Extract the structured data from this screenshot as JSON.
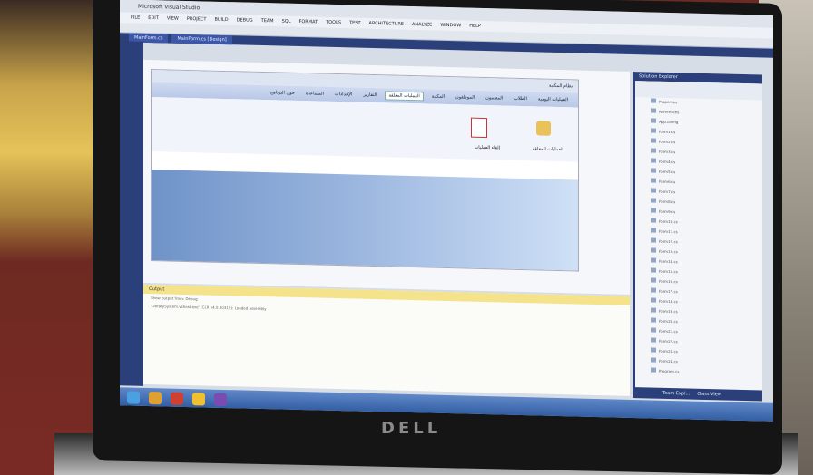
{
  "window": {
    "title": "Microsoft Visual Studio"
  },
  "menu": [
    "FILE",
    "EDIT",
    "VIEW",
    "PROJECT",
    "BUILD",
    "DEBUG",
    "TEAM",
    "SQL",
    "FORMAT",
    "TOOLS",
    "TEST",
    "ARCHITECTURE",
    "ANALYZE",
    "WINDOW",
    "HELP"
  ],
  "tabs": [
    "MainForm.cs",
    "MainForm.cs [Design]"
  ],
  "form": {
    "title": "نظام المكتبة",
    "ribbon_tabs": [
      "العمليات اليومية",
      "الطلاب",
      "المعلمون",
      "الموظفون",
      "المكتبة",
      "العمليات المعلقة",
      "التقارير",
      "الإعدادات",
      "المساعدة",
      "حول البرنامج"
    ],
    "active_tab_index": 5,
    "action_labels": [
      "العمليات المعلقة",
      "إلغاء العمليات"
    ]
  },
  "output": {
    "title": "Output",
    "lines": [
      "Show output from: Debug",
      "'LibrarySystem.vshost.exe' (CLR v4.0.30319): Loaded assembly"
    ]
  },
  "solution_explorer": {
    "title": "Solution Explorer",
    "items": [
      "Properties",
      "References",
      "App.config",
      "Form1.cs",
      "Form2.cs",
      "Form3.cs",
      "Form4.cs",
      "Form5.cs",
      "Form6.cs",
      "Form7.cs",
      "Form8.cs",
      "Form9.cs",
      "Form10.cs",
      "Form11.cs",
      "Form12.cs",
      "Form13.cs",
      "Form14.cs",
      "Form15.cs",
      "Form16.cs",
      "Form17.cs",
      "Form18.cs",
      "Form19.cs",
      "Form20.cs",
      "Form21.cs",
      "Form22.cs",
      "Form23.cs",
      "Form24.cs",
      "Program.cs"
    ],
    "footer": [
      "Team Expl...",
      "Class View"
    ]
  },
  "laptop": {
    "brand": "DELL"
  }
}
